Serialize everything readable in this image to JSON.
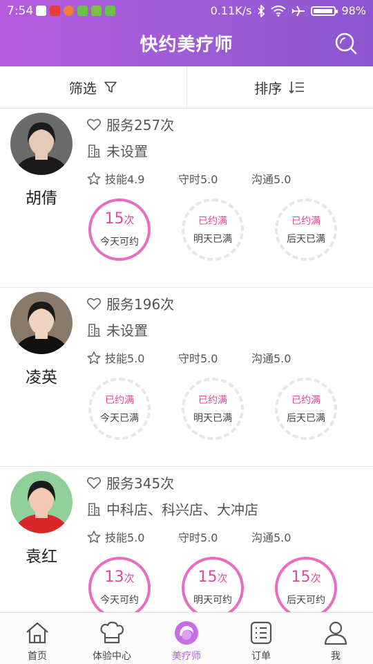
{
  "status": {
    "time": "7:54",
    "speed": "0.11K/s",
    "battery": "98%",
    "app_icon_colors": [
      "#e43b3b",
      "#d9442e",
      "#ee7f3a",
      "#6cc04a",
      "#7bc043",
      "#6cbf4f"
    ]
  },
  "header": {
    "title": "快约美疗师",
    "search_icon": "search-icon"
  },
  "filterbar": {
    "filter_label": "筛选",
    "sort_label": "排序"
  },
  "therapists": [
    {
      "name": "胡倩",
      "service": "服务257次",
      "store": "未设置",
      "skill": "技能4.9",
      "punctual": "守时5.0",
      "communication": "沟通5.0",
      "avatar_colors": [
        "#6b6b6b",
        "#e8c9b8",
        "#1a1a1a"
      ],
      "slots": [
        {
          "state": "open",
          "count": "15",
          "unit": "次",
          "label": "今天可约"
        },
        {
          "state": "full",
          "status": "已约满",
          "label": "明天已满"
        },
        {
          "state": "full",
          "status": "已约满",
          "label": "后天已满"
        }
      ]
    },
    {
      "name": "凌英",
      "service": "服务196次",
      "store": "未设置",
      "skill": "技能5.0",
      "punctual": "守时5.0",
      "communication": "沟通5.0",
      "avatar_colors": [
        "#8b7a6a",
        "#f1d3c2",
        "#111"
      ],
      "slots": [
        {
          "state": "full",
          "status": "已约满",
          "label": "今天已满"
        },
        {
          "state": "full",
          "status": "已约满",
          "label": "明天已满"
        },
        {
          "state": "full",
          "status": "已约满",
          "label": "后天已满"
        }
      ]
    },
    {
      "name": "袁红",
      "service": "服务345次",
      "store": "中科店、科兴店、大冲店",
      "skill": "技能5.0",
      "punctual": "守时5.0",
      "communication": "沟通5.0",
      "avatar_colors": [
        "#8ecf9a",
        "#f2c8b3",
        "#d8262a"
      ],
      "slots": [
        {
          "state": "open",
          "count": "13",
          "unit": "次",
          "label": "今天可约"
        },
        {
          "state": "open",
          "count": "15",
          "unit": "次",
          "label": "明天可约"
        },
        {
          "state": "open",
          "count": "15",
          "unit": "次",
          "label": "后天可约"
        }
      ]
    }
  ],
  "bottomnav": {
    "items": [
      {
        "label": "首页",
        "icon": "home-icon"
      },
      {
        "label": "体验中心",
        "icon": "chef-hat-icon"
      },
      {
        "label": "美疗师",
        "icon": "therapist-icon",
        "active": true
      },
      {
        "label": "订单",
        "icon": "order-list-icon"
      },
      {
        "label": "我",
        "icon": "profile-icon"
      }
    ]
  },
  "colors": {
    "accent": "#b25ee0",
    "pink": "#e0489e",
    "ring": "#ea6cc0"
  }
}
